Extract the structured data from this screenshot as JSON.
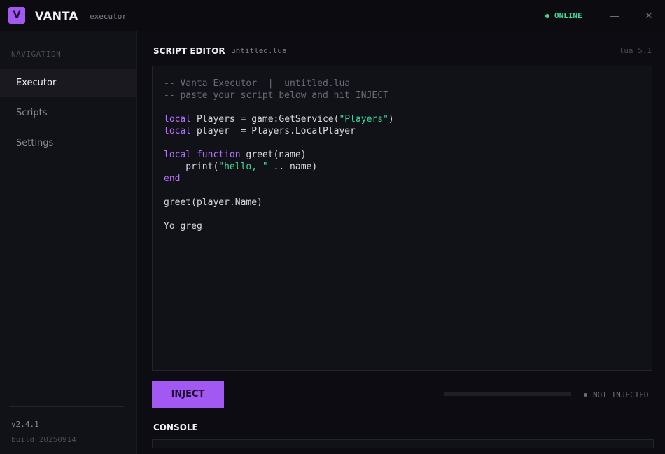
{
  "app": {
    "logo_letter": "V",
    "name": "VANTA",
    "subtitle": "executor",
    "status": "ONLINE"
  },
  "window": {
    "minimize_icon": "minimize-icon",
    "close_icon": "close-icon",
    "close_glyph": "✕"
  },
  "sidebar": {
    "heading": "NAVIGATION",
    "items": [
      {
        "label": "Executor",
        "active": true
      },
      {
        "label": "Scripts",
        "active": false
      },
      {
        "label": "Settings",
        "active": false
      }
    ],
    "version": "v2.4.1",
    "build": "build 20250914"
  },
  "editor": {
    "title": "SCRIPT EDITOR",
    "file": "untitled.lua",
    "language": "lua 5.1",
    "lines": [
      "-- Vanta Executor  |  untitled.lua",
      "-- paste your script below and hit INJECT",
      "",
      "local Players = game:GetService(\"Players\")",
      "local player  = Players.LocalPlayer",
      "",
      "local function greet(name)",
      "    print(\"hello, \" .. name)",
      "end",
      "",
      "greet(player.Name)",
      "",
      "Yo greg"
    ]
  },
  "actions": {
    "inject_label": "INJECT",
    "inject_progress": 0,
    "inject_status": "NOT INJECTED"
  },
  "console": {
    "title": "CONSOLE"
  },
  "colors": {
    "accent": "#a259f2",
    "online": "#3ddc97",
    "string": "#3ddc97",
    "keyword": "#b870ff",
    "comment": "#6b6b7a"
  }
}
